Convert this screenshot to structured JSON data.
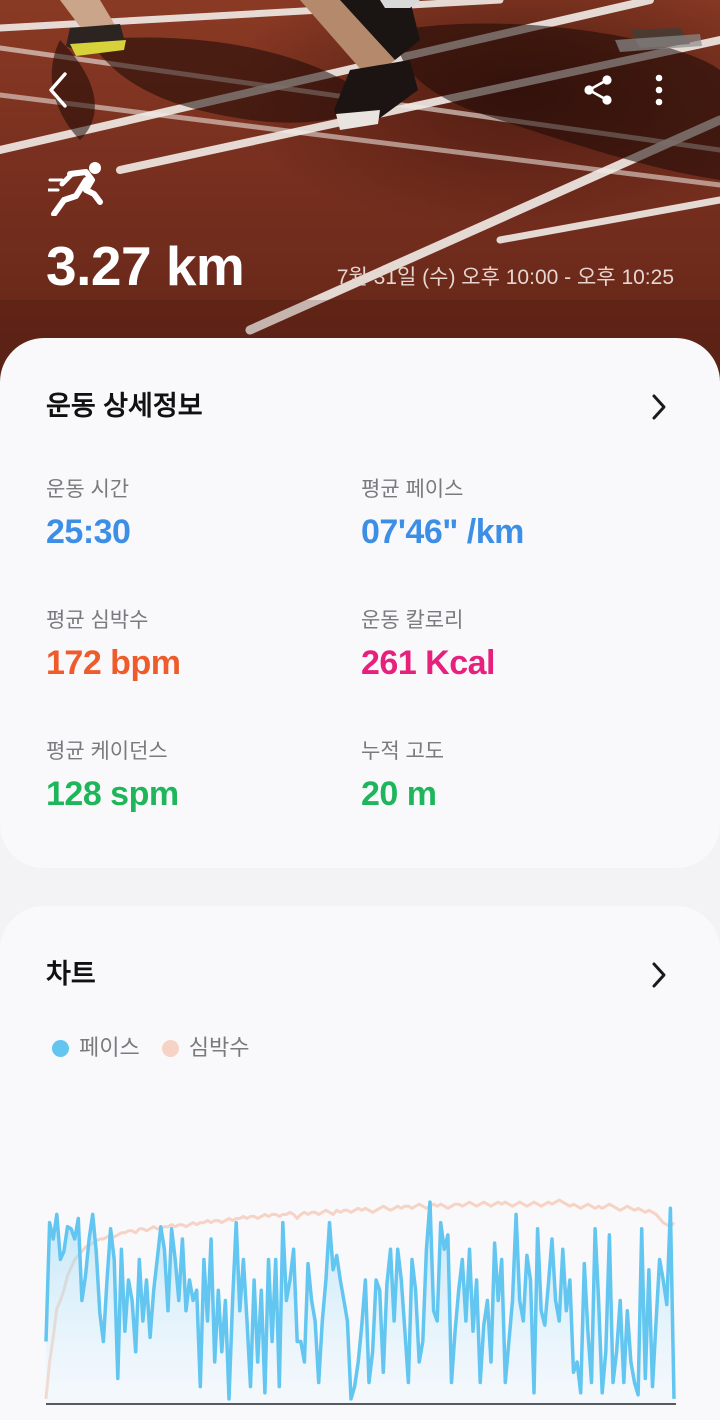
{
  "hero": {
    "distance": "3.27 km",
    "datetime": "7월 31일 (수) 오후 10:00 - 오후 10:25",
    "icons": [
      "back-arrow-icon",
      "share-icon",
      "more-vertical-icon",
      "running-icon"
    ]
  },
  "details": {
    "title": "운동 상세정보",
    "stats": [
      {
        "label": "운동 시간",
        "value": "25:30",
        "color": "#3d8fe6"
      },
      {
        "label": "평균 페이스",
        "value": "07'46\" /km",
        "color": "#3d8fe6"
      },
      {
        "label": "평균 심박수",
        "value": "172 bpm",
        "color": "#ee5c2b"
      },
      {
        "label": "운동 칼로리",
        "value": "261 Kcal",
        "color": "#e8207d"
      },
      {
        "label": "평균 케이던스",
        "value": "128 spm",
        "color": "#1fb65b"
      },
      {
        "label": "누적 고도",
        "value": "20 m",
        "color": "#1fb65b"
      }
    ]
  },
  "chart": {
    "title": "차트",
    "legend": [
      {
        "label": "페이스",
        "color": "#62c6f1"
      },
      {
        "label": "심박수",
        "color": "#f6d3c4"
      }
    ]
  },
  "chart_data": {
    "type": "line",
    "title": "",
    "xlabel": "",
    "ylabel": "",
    "ylim": [
      0,
      100
    ],
    "grid": false,
    "legend_position": "top-left",
    "series": [
      {
        "name": "페이스",
        "color": "#62c6f1",
        "values": [
          30,
          88,
          80,
          92,
          70,
          74,
          86,
          85,
          80,
          90,
          50,
          62,
          80,
          92,
          74,
          44,
          30,
          60,
          85,
          70,
          12,
          75,
          35,
          60,
          50,
          25,
          70,
          40,
          60,
          32,
          55,
          70,
          86,
          75,
          45,
          85,
          70,
          50,
          80,
          45,
          60,
          50,
          55,
          8,
          70,
          40,
          80,
          20,
          55,
          25,
          50,
          2,
          50,
          88,
          45,
          70,
          40,
          8,
          60,
          20,
          55,
          5,
          70,
          30,
          70,
          8,
          88,
          50,
          60,
          75,
          30,
          30,
          20,
          68,
          50,
          40,
          10,
          40,
          60,
          88,
          65,
          72,
          60,
          50,
          40,
          2,
          8,
          20,
          38,
          60,
          10,
          25,
          60,
          55,
          15,
          58,
          75,
          40,
          75,
          60,
          35,
          10,
          70,
          55,
          20,
          30,
          75,
          98,
          45,
          40,
          88,
          75,
          82,
          10,
          35,
          55,
          70,
          40,
          75,
          35,
          60,
          10,
          38,
          50,
          20,
          78,
          50,
          70,
          10,
          30,
          50,
          92,
          50,
          40,
          72,
          60,
          5,
          85,
          45,
          38,
          58,
          80,
          50,
          40,
          75,
          45,
          60,
          15,
          20,
          5,
          68,
          35,
          10,
          85,
          50,
          5,
          25,
          82,
          10,
          25,
          50,
          10,
          45,
          20,
          10,
          4,
          85,
          12,
          65,
          8,
          40,
          70,
          60,
          48,
          95,
          2
        ]
      },
      {
        "name": "심박수",
        "color": "#f6d3c4",
        "values": [
          2,
          20,
          32,
          46,
          50,
          55,
          62,
          66,
          70,
          72,
          74,
          76,
          77,
          78,
          79,
          80,
          80,
          81,
          82,
          81,
          82,
          83,
          83,
          84,
          84,
          83,
          85,
          85,
          84,
          85,
          86,
          85,
          85,
          86,
          86,
          87,
          86,
          87,
          87,
          86,
          87,
          88,
          87,
          88,
          88,
          89,
          88,
          89,
          89,
          88,
          89,
          90,
          89,
          90,
          90,
          91,
          90,
          91,
          91,
          90,
          91,
          92,
          91,
          92,
          92,
          91,
          92,
          92,
          93,
          92,
          90,
          92,
          93,
          92,
          93,
          93,
          92,
          93,
          94,
          93,
          92,
          94,
          93,
          94,
          94,
          93,
          94,
          95,
          94,
          95,
          94,
          93,
          94,
          95,
          96,
          95,
          94,
          95,
          96,
          95,
          96,
          96,
          95,
          96,
          97,
          96,
          95,
          96,
          97,
          96,
          97,
          96,
          95,
          96,
          97,
          97,
          96,
          97,
          98,
          97,
          96,
          97,
          98,
          97,
          96,
          97,
          98,
          97,
          98,
          97,
          96,
          97,
          98,
          97,
          96,
          97,
          98,
          97,
          96,
          97,
          98,
          97,
          98,
          99,
          98,
          97,
          96,
          97,
          96,
          95,
          96,
          97,
          96,
          95,
          96,
          95,
          96,
          97,
          96,
          95,
          94,
          95,
          96,
          95,
          94,
          95,
          94,
          93,
          94,
          93,
          92,
          90,
          88,
          87,
          86,
          88
        ]
      }
    ]
  }
}
